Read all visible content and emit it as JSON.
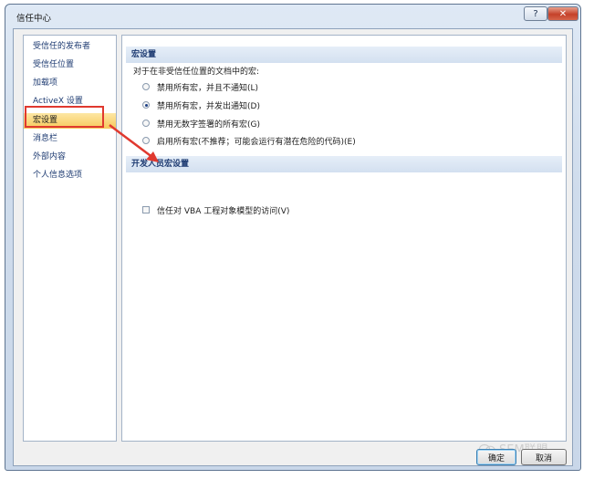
{
  "window": {
    "title": "信任中心",
    "help_glyph": "?",
    "close_glyph": "✕"
  },
  "sidebar": {
    "items": [
      {
        "label": "受信任的发布者"
      },
      {
        "label": "受信任位置"
      },
      {
        "label": "加载项"
      },
      {
        "label": "ActiveX 设置"
      },
      {
        "label": "宏设置"
      },
      {
        "label": "消息栏"
      },
      {
        "label": "外部内容"
      },
      {
        "label": "个人信息选项"
      }
    ],
    "selected_index": 4
  },
  "macro_settings": {
    "header": "宏设置",
    "description": "对于在非受信任位置的文档中的宏:",
    "options": [
      {
        "label": "禁用所有宏，并且不通知(L)",
        "checked": false
      },
      {
        "label": "禁用所有宏，并发出通知(D)",
        "checked": true
      },
      {
        "label": "禁用无数字签署的所有宏(G)",
        "checked": false
      },
      {
        "label": "启用所有宏(不推荐；可能会运行有潜在危险的代码)(E)",
        "checked": false
      }
    ]
  },
  "developer_settings": {
    "header": "开发人员宏设置",
    "checkbox_label": "信任对 VBA 工程对象模型的访问(V)",
    "checked": false
  },
  "footer": {
    "ok_label": "确定",
    "cancel_label": "取消"
  },
  "watermark": {
    "text": "SEM联盟"
  },
  "colors": {
    "annotation": "#e0392f",
    "selected_bg": "#f7c95b",
    "link_text": "#1e3b72"
  }
}
